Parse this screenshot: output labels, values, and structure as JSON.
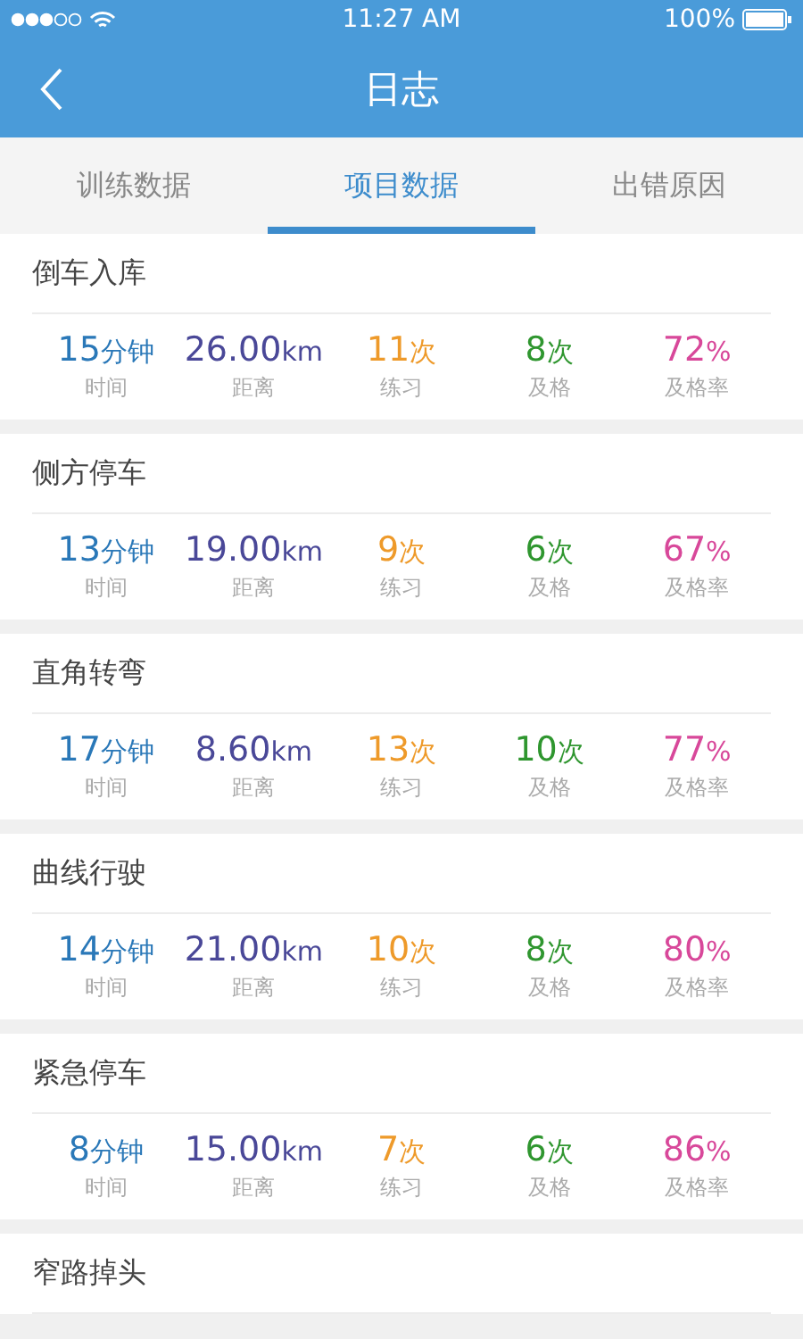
{
  "status_bar": {
    "time": "11:27 AM",
    "battery": "100%"
  },
  "header": {
    "title": "日志"
  },
  "tabs": [
    {
      "label": "训练数据",
      "selected": false
    },
    {
      "label": "项目数据",
      "selected": true
    },
    {
      "label": "出错原因",
      "selected": false
    }
  ],
  "items": [
    {
      "title": "倒车入库",
      "stats": [
        {
          "value": "15",
          "unit": "分钟",
          "label": "时间",
          "color": "#2a78b8"
        },
        {
          "value": "26.00",
          "unit": "km",
          "label": "距离",
          "color": "#4a4898"
        },
        {
          "value": "11",
          "unit": "次",
          "label": "练习",
          "color": "#ee9a2a"
        },
        {
          "value": "8",
          "unit": "次",
          "label": "及格",
          "color": "#2f962f"
        },
        {
          "value": "72",
          "unit": "%",
          "label": "及格率",
          "color": "#d8489a"
        }
      ]
    },
    {
      "title": "侧方停车",
      "stats": [
        {
          "value": "13",
          "unit": "分钟",
          "label": "时间",
          "color": "#2a78b8"
        },
        {
          "value": "19.00",
          "unit": "km",
          "label": "距离",
          "color": "#4a4898"
        },
        {
          "value": "9",
          "unit": "次",
          "label": "练习",
          "color": "#ee9a2a"
        },
        {
          "value": "6",
          "unit": "次",
          "label": "及格",
          "color": "#2f962f"
        },
        {
          "value": "67",
          "unit": "%",
          "label": "及格率",
          "color": "#d8489a"
        }
      ]
    },
    {
      "title": "直角转弯",
      "stats": [
        {
          "value": "17",
          "unit": "分钟",
          "label": "时间",
          "color": "#2a78b8"
        },
        {
          "value": "8.60",
          "unit": "km",
          "label": "距离",
          "color": "#4a4898"
        },
        {
          "value": "13",
          "unit": "次",
          "label": "练习",
          "color": "#ee9a2a"
        },
        {
          "value": "10",
          "unit": "次",
          "label": "及格",
          "color": "#2f962f"
        },
        {
          "value": "77",
          "unit": "%",
          "label": "及格率",
          "color": "#d8489a"
        }
      ]
    },
    {
      "title": "曲线行驶",
      "stats": [
        {
          "value": "14",
          "unit": "分钟",
          "label": "时间",
          "color": "#2a78b8"
        },
        {
          "value": "21.00",
          "unit": "km",
          "label": "距离",
          "color": "#4a4898"
        },
        {
          "value": "10",
          "unit": "次",
          "label": "练习",
          "color": "#ee9a2a"
        },
        {
          "value": "8",
          "unit": "次",
          "label": "及格",
          "color": "#2f962f"
        },
        {
          "value": "80",
          "unit": "%",
          "label": "及格率",
          "color": "#d8489a"
        }
      ]
    },
    {
      "title": "紧急停车",
      "stats": [
        {
          "value": "8",
          "unit": "分钟",
          "label": "时间",
          "color": "#2a78b8"
        },
        {
          "value": "15.00",
          "unit": "km",
          "label": "距离",
          "color": "#4a4898"
        },
        {
          "value": "7",
          "unit": "次",
          "label": "练习",
          "color": "#ee9a2a"
        },
        {
          "value": "6",
          "unit": "次",
          "label": "及格",
          "color": "#2f962f"
        },
        {
          "value": "86",
          "unit": "%",
          "label": "及格率",
          "color": "#d8489a"
        }
      ]
    },
    {
      "title": "窄路掉头"
    }
  ]
}
